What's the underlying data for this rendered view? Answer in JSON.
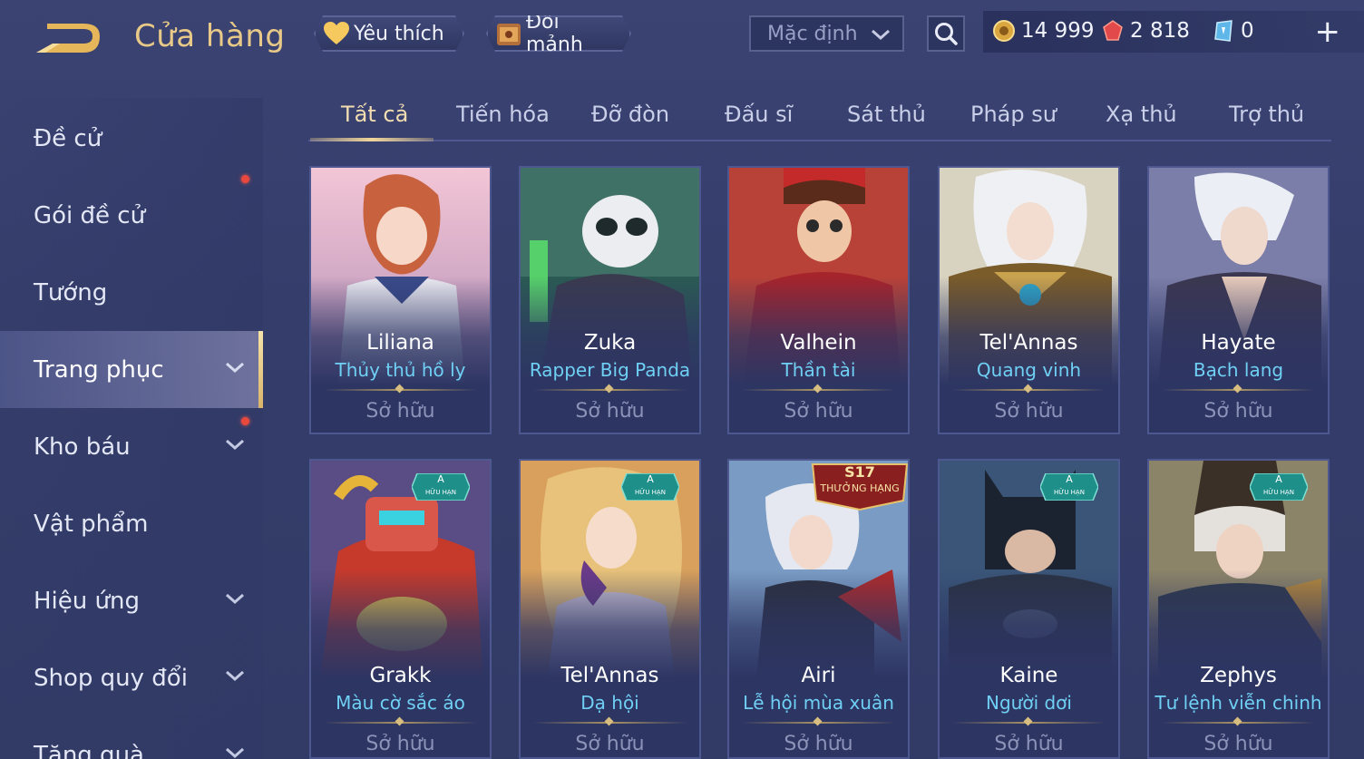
{
  "header": {
    "title": "Cửa hàng",
    "favorite_label": "Yêu thích",
    "exchange_label": "Đổi mảnh",
    "sort_value": "Mặc định",
    "currencies": [
      {
        "icon": "gold-coin-icon",
        "value": "14 999"
      },
      {
        "icon": "red-gem-icon",
        "value": "2 818"
      },
      {
        "icon": "ticket-icon",
        "value": "0"
      }
    ],
    "plus_label": "+"
  },
  "sidebar": {
    "items": [
      {
        "label": "Đề cử",
        "has_chevron": false,
        "dot": false
      },
      {
        "label": "Gói đề cử",
        "has_chevron": false,
        "dot": true
      },
      {
        "label": "Tướng",
        "has_chevron": false,
        "dot": false
      },
      {
        "label": "Trang phục",
        "has_chevron": true,
        "dot": false,
        "active": true
      },
      {
        "label": "Kho báu",
        "has_chevron": true,
        "dot": true
      },
      {
        "label": "Vật phẩm",
        "has_chevron": false,
        "dot": false
      },
      {
        "label": "Hiệu ứng",
        "has_chevron": true,
        "dot": false
      },
      {
        "label": "Shop quy đổi",
        "has_chevron": true,
        "dot": false
      },
      {
        "label": "Tặng quà",
        "has_chevron": true,
        "dot": false
      }
    ]
  },
  "tabs": [
    "Tất cả",
    "Tiến hóa",
    "Đỡ đòn",
    "Đấu sĩ",
    "Sát thủ",
    "Pháp sư",
    "Xạ thủ",
    "Trợ thủ"
  ],
  "cards": [
    {
      "hero": "Liliana",
      "skin": "Thủy thủ hồ ly",
      "status": "Sở hữu"
    },
    {
      "hero": "Zuka",
      "skin": "Rapper Big Panda",
      "status": "Sở hữu"
    },
    {
      "hero": "Valhein",
      "skin": "Thần tài",
      "status": "Sở hữu"
    },
    {
      "hero": "Tel'Annas",
      "skin": "Quang vinh",
      "status": "Sở hữu"
    },
    {
      "hero": "Hayate",
      "skin": "Bạch lang",
      "status": "Sở hữu"
    },
    {
      "hero": "Grakk",
      "skin": "Màu cờ sắc áo",
      "status": "Sở hữu",
      "badge": "limited"
    },
    {
      "hero": "Tel'Annas",
      "skin": "Dạ hội",
      "status": "Sở hữu",
      "badge": "limited"
    },
    {
      "hero": "Airi",
      "skin": "Lễ hội mùa xuân",
      "status": "Sở hữu",
      "badge": "rank"
    },
    {
      "hero": "Kaine",
      "skin": "Người dơi",
      "status": "Sở hữu",
      "badge": "limited"
    },
    {
      "hero": "Zephys",
      "skin": "Tư lệnh viễn chinh",
      "status": "Sở hữu",
      "badge": "limited"
    }
  ],
  "badges": {
    "limited_top": "A",
    "limited_bottom": "HỮU HẠN",
    "rank_top": "S17",
    "rank_bottom": "THƯỞNG HẠNG"
  },
  "colors": {
    "accent_gold": "#e8c987",
    "skin_name": "#6fd0f4",
    "background": "#373f6e"
  }
}
